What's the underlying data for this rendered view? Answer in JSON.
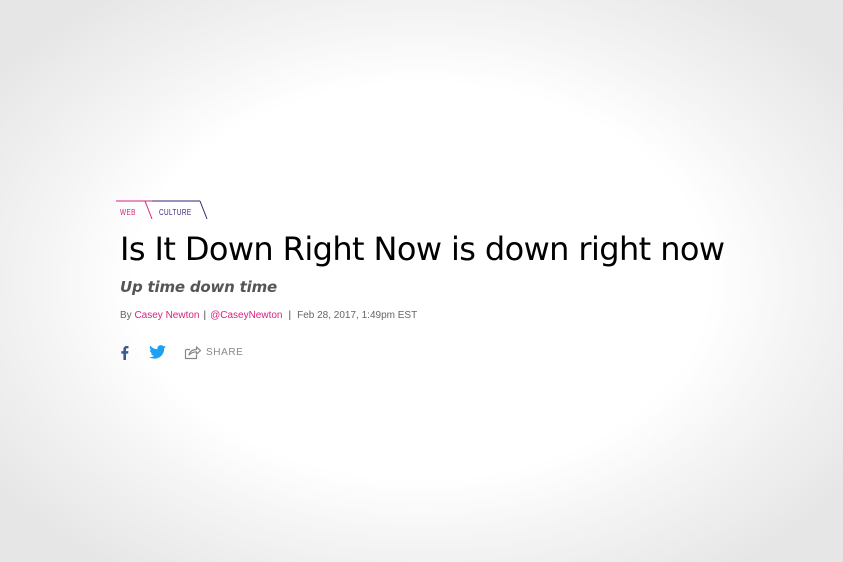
{
  "breadcrumb": {
    "items": [
      {
        "label": "WEB",
        "color": "#d6247d"
      },
      {
        "label": "CULTURE",
        "color": "#3a1f7a"
      }
    ]
  },
  "article": {
    "headline": "Is It Down Right Now is down right now",
    "dek": "Up time down time",
    "byline": {
      "prefix": "By",
      "author": "Casey Newton",
      "separator": "|",
      "handle": "@CaseyNewton",
      "separator2": "|",
      "timestamp": "Feb 28, 2017, 1:49pm EST"
    }
  },
  "share": {
    "facebook_icon": "facebook-icon",
    "twitter_icon": "twitter-icon",
    "share_icon": "share-icon",
    "share_label": "SHARE"
  },
  "colors": {
    "accent_pink": "#d6247d",
    "accent_purple": "#3a1f7a",
    "facebook_blue": "#3b5998",
    "twitter_blue": "#1da1f2"
  }
}
